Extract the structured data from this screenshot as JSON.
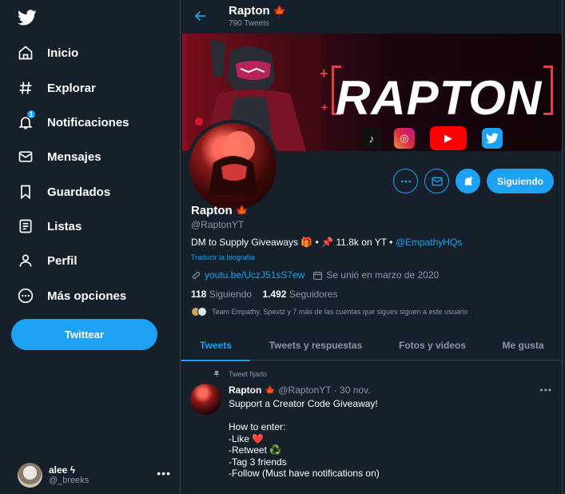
{
  "sidebar": {
    "logo_icon": "twitter-bird-icon",
    "items": [
      {
        "label": "Inicio",
        "icon": "home-icon"
      },
      {
        "label": "Explorar",
        "icon": "hashtag-icon"
      },
      {
        "label": "Notificaciones",
        "icon": "bell-icon",
        "badge": "1"
      },
      {
        "label": "Mensajes",
        "icon": "mail-icon"
      },
      {
        "label": "Guardados",
        "icon": "bookmark-icon"
      },
      {
        "label": "Listas",
        "icon": "list-icon"
      },
      {
        "label": "Perfil",
        "icon": "person-icon"
      },
      {
        "label": "Más opciones",
        "icon": "more-circle-icon"
      }
    ],
    "tweet_button": "Twittear",
    "account": {
      "name": "alee ϟ",
      "handle": "@_breeks",
      "more": "•••"
    }
  },
  "header": {
    "title": "Rapton",
    "flag": "🍁",
    "subtitle": "790 Tweets"
  },
  "banner": {
    "title": "RAPTON",
    "socials": [
      "tiktok-icon",
      "instagram-icon",
      "youtube-icon",
      "twitter-icon"
    ]
  },
  "profile": {
    "name": "Rapton",
    "flag": "🍁",
    "handle": "@RaptonYT",
    "bio_text": "DM to Supply Giveaways 🎁 • 📌 11.8k on YT • ",
    "bio_link": "@EmpathyHQs",
    "translate": "Traducir la biografía",
    "website": "youtu.be/UczJ51sS7ew",
    "joined": "Se unió en marzo de 2020",
    "following_count": "118",
    "following_label": "Siguiendo",
    "followers_count": "1.492",
    "followers_label": "Seguidores",
    "known_followers": "Team Empathy, Spextz y 7 más de las cuentas que sigues siguen a este usuario",
    "follow_button": "Siguiendo",
    "more_icon": "more-icon",
    "message_icon": "mail-icon",
    "notify_icon": "bell-plus-icon"
  },
  "tabs": [
    {
      "label": "Tweets",
      "active": true
    },
    {
      "label": "Tweets y respuestas",
      "active": false
    },
    {
      "label": "Fotos y videos",
      "active": false
    },
    {
      "label": "Me gusta",
      "active": false
    }
  ],
  "tweet": {
    "pinned_label": "Tweet fijado",
    "author": "Rapton",
    "flag": "🍁",
    "handle": "@RaptonYT",
    "time": "· 30 nov.",
    "more": "•••",
    "lines": [
      "Support a Creator Code Giveaway!",
      "",
      "How to enter:",
      "-Like ❤️",
      "-Retweet ♻️",
      "-Tag 3 friends",
      "-Follow (Must have notifications on)"
    ]
  },
  "colors": {
    "background": "#15202b",
    "accent": "#1da1f2",
    "muted": "#8899a6",
    "border": "#38444d"
  }
}
